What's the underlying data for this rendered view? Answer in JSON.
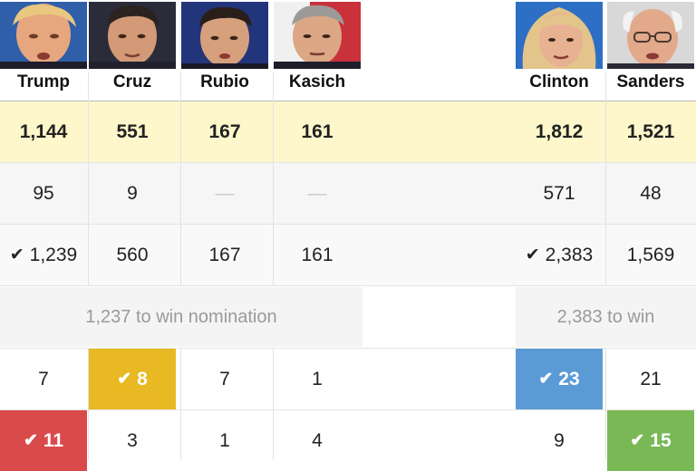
{
  "colors": {
    "pledged_bg": "#fdf7cb",
    "cruz_win": "#e8b923",
    "trump_win": "#d94b4b",
    "clinton_win": "#5b9bd5",
    "sanders_win": "#7ab856"
  },
  "republicans": {
    "win_threshold_text": "1,237 to win nomination",
    "candidates": [
      {
        "name": "Trump",
        "pledged": "1,144",
        "super": "95",
        "total": "1,239",
        "total_check": "✔",
        "state1": "7",
        "state2": "11",
        "state2_check": "✔"
      },
      {
        "name": "Cruz",
        "pledged": "551",
        "super": "9",
        "total": "560",
        "state1": "8",
        "state1_check": "✔",
        "state2": "3"
      },
      {
        "name": "Rubio",
        "pledged": "167",
        "super": "—",
        "total": "167",
        "state1": "7",
        "state2": "1"
      },
      {
        "name": "Kasich",
        "pledged": "161",
        "super": "—",
        "total": "161",
        "state1": "1",
        "state2": "4"
      }
    ]
  },
  "democrats": {
    "win_threshold_text": "2,383 to win",
    "candidates": [
      {
        "name": "Clinton",
        "pledged": "1,812",
        "super": "571",
        "total": "2,383",
        "total_check": "✔",
        "state1": "23",
        "state1_check": "✔",
        "state2": "9"
      },
      {
        "name": "Sanders",
        "pledged": "1,521",
        "super": "48",
        "total": "1,569",
        "state1": "21",
        "state2": "15",
        "state2_check": "✔"
      }
    ]
  }
}
